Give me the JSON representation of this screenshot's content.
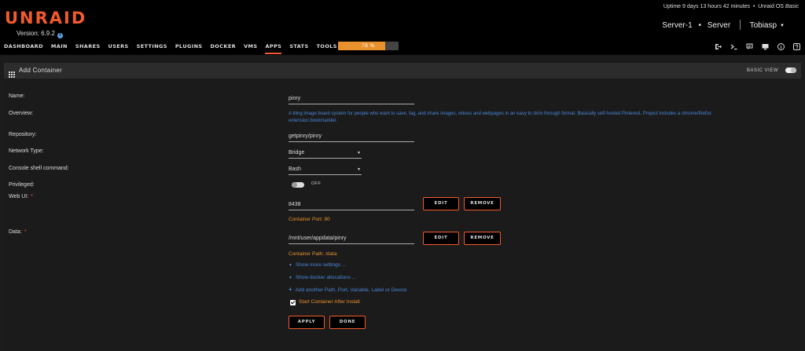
{
  "header": {
    "logo": "UNRAID",
    "version": "Version: 6.9.2",
    "uptime_prefix": "Uptime 9 days 13 hours 42 minutes",
    "uptime_bullet": "•",
    "os_label": "Unraid OS ",
    "os_edition": "Basic",
    "server_name": "Server-1",
    "server_dot": "•",
    "server_desc": "Server",
    "user": "Tobiasp",
    "accent_color": "#f15a2c"
  },
  "nav": {
    "tabs": [
      "DASHBOARD",
      "MAIN",
      "SHARES",
      "USERS",
      "SETTINGS",
      "PLUGINS",
      "DOCKER",
      "VMS",
      "APPS",
      "STATS",
      "TOOLS"
    ],
    "active_tab": "APPS",
    "progress_percent": 78,
    "progress_label": "78 %",
    "icons": [
      "logout-icon",
      "terminal-icon",
      "feedback-icon",
      "monitor-icon",
      "info-icon",
      "help-icon"
    ]
  },
  "panel": {
    "title": "Add Container",
    "basic_view_label": "BASIC VIEW"
  },
  "form": {
    "name_label": "Name:",
    "name_value": "pinry",
    "overview_label": "Overview:",
    "overview_text": "A tiling image board system for people who want to save, tag, and share images, videos and webpages in an easy to skim through format. Basically self-hosted Pinterest. Project includes a chrome/firefox extension bookmarklet.",
    "repository_label": "Repository:",
    "repository_value": "getpinry/pinry",
    "network_label": "Network Type:",
    "network_value": "Bridge",
    "console_label": "Console shell command:",
    "console_value": "Bash",
    "privileged_label": "Privileged:",
    "privileged_state": "OFF",
    "webui_label": "Web UI:",
    "required_mark": "*",
    "webui_value": "8438",
    "webui_note": "Container Port: 80",
    "data_label": "Data:",
    "data_value": "/mnt/user/appdata/pinry",
    "data_note": "Container Path: /data",
    "edit_label": "EDIT",
    "remove_label": "REMOVE",
    "show_more": "Show more settings ...",
    "show_allocations": "Show docker allocations ...",
    "add_another": "Add another Path, Port, Variable, Label or Device",
    "start_after_install": "Start Container After Install",
    "start_checked": true,
    "apply_label": "APPLY",
    "done_label": "DONE"
  }
}
